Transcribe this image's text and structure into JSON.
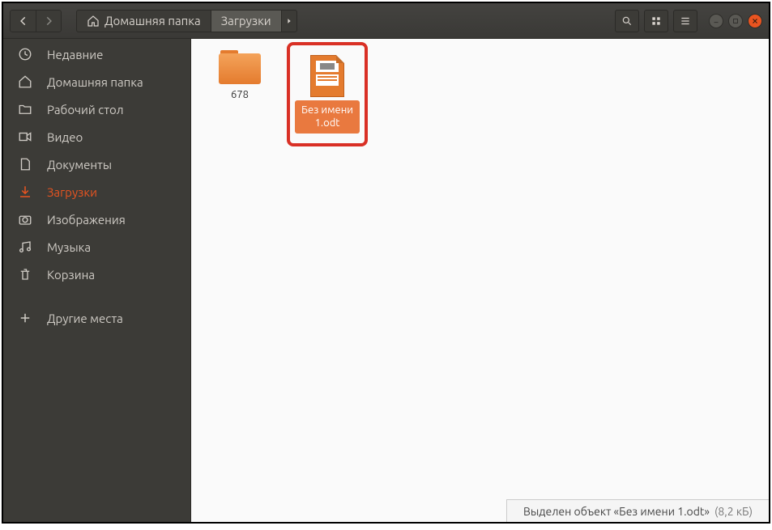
{
  "colors": {
    "accent": "#e95420"
  },
  "header": {
    "breadcrumb": {
      "home_label": "Домашняя папка",
      "current": "Загрузки"
    }
  },
  "sidebar": {
    "items": [
      {
        "name": "recent",
        "label": "Недавние",
        "icon": "clock-icon"
      },
      {
        "name": "home",
        "label": "Домашняя папка",
        "icon": "home-icon"
      },
      {
        "name": "desktop",
        "label": "Рабочий стол",
        "icon": "desktop-folder-icon"
      },
      {
        "name": "videos",
        "label": "Видео",
        "icon": "video-icon"
      },
      {
        "name": "documents",
        "label": "Документы",
        "icon": "document-icon"
      },
      {
        "name": "downloads",
        "label": "Загрузки",
        "icon": "download-icon",
        "active": true
      },
      {
        "name": "pictures",
        "label": "Изображения",
        "icon": "camera-icon"
      },
      {
        "name": "music",
        "label": "Музыка",
        "icon": "music-icon"
      },
      {
        "name": "trash",
        "label": "Корзина",
        "icon": "trash-icon"
      }
    ],
    "other_item": {
      "label": "Другие места",
      "icon": "plus-icon"
    }
  },
  "main": {
    "items": [
      {
        "type": "folder",
        "label": "678",
        "selected": false
      },
      {
        "type": "file",
        "label": "Без имени 1.odt",
        "selected": true
      }
    ]
  },
  "status": {
    "text": "Выделен объект «Без имени 1.odt»",
    "size": "(8,2 кБ)"
  }
}
